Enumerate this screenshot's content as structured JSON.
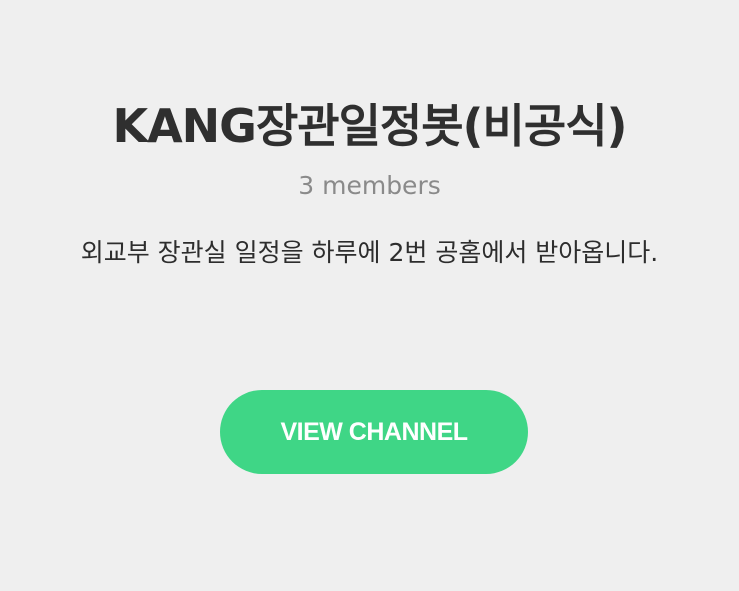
{
  "channel": {
    "title": "KANG장관일정봇(비공식)",
    "member_count": "3 members",
    "description": "외교부 장관실 일정을 하루에 2번 공홈에서 받아옵니다.",
    "view_button_label": "VIEW CHANNEL"
  },
  "colors": {
    "background": "#efefef",
    "title_text": "#2f2f2f",
    "member_text": "#8a8a8a",
    "button_background": "#3fd686",
    "button_text": "#ffffff"
  }
}
